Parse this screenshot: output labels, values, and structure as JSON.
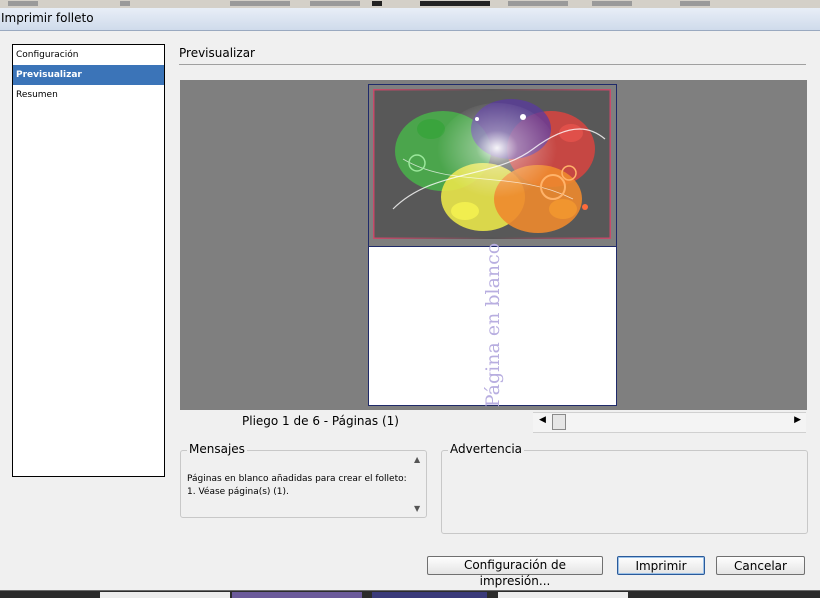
{
  "window": {
    "title": "Imprimir folleto"
  },
  "sidebar": {
    "items": [
      {
        "label": "Configuración"
      },
      {
        "label": "Previsualizar"
      },
      {
        "label": "Resumen"
      }
    ]
  },
  "preview": {
    "section_title": "Previsualizar",
    "blank_page_text": "Página en blanco",
    "spread_label": "Pliego 1 de 6 - Páginas (1)",
    "spread_scroll_position": 0
  },
  "messages": {
    "label": "Mensajes",
    "text": "Páginas en blanco añadidas para crear el folleto: 1. Véase página(s) (1)."
  },
  "warning": {
    "label": "Advertencia",
    "text": ""
  },
  "buttons": {
    "print_setup": "Configuración de impresión...",
    "print": "Imprimir",
    "cancel": "Cancelar"
  },
  "colors": {
    "selection": "#3b74b8",
    "preview_background": "#7f7f7f",
    "page_border": "#1f2a6a",
    "blank_text": "#b8aee0"
  }
}
